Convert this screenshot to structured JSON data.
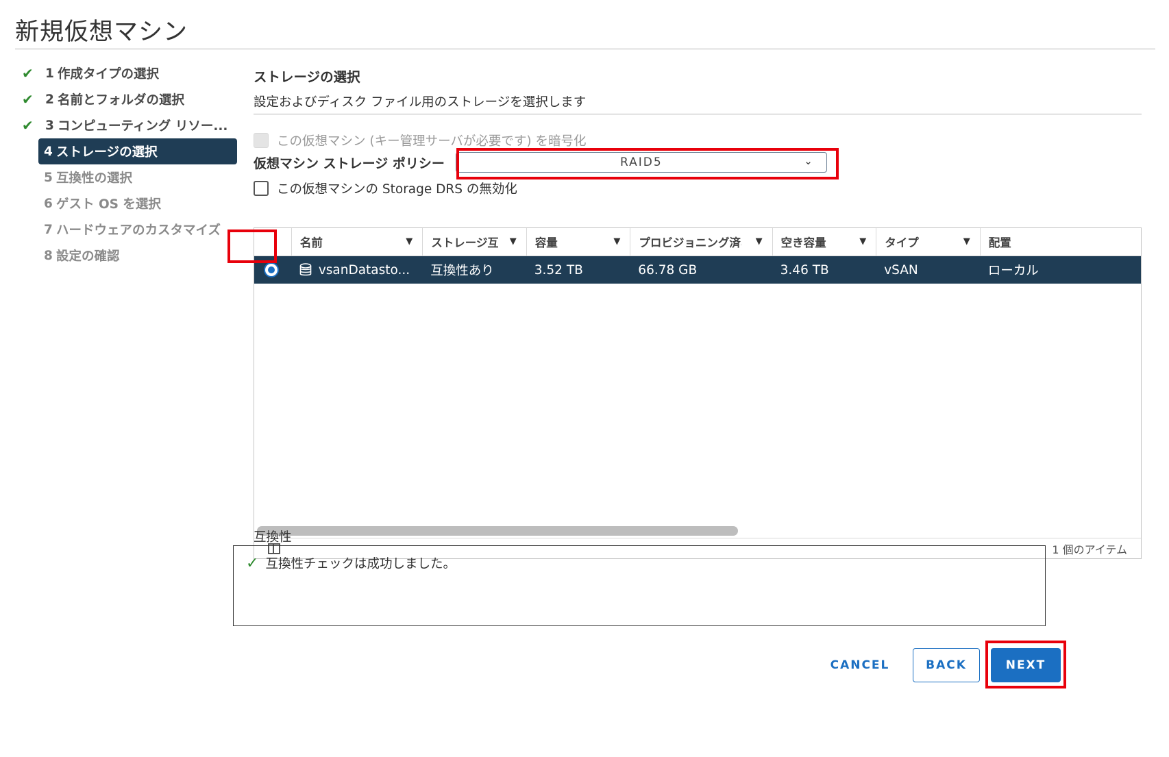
{
  "wizard": {
    "title": "新規仮想マシン",
    "steps": [
      {
        "num": "1",
        "label": "作成タイプの選択",
        "state": "done"
      },
      {
        "num": "2",
        "label": "名前とフォルダの選択",
        "state": "done"
      },
      {
        "num": "3",
        "label": "コンピューティング リソー...",
        "state": "done"
      },
      {
        "num": "4",
        "label": "ストレージの選択",
        "state": "active"
      },
      {
        "num": "5",
        "label": "互換性の選択",
        "state": "pending"
      },
      {
        "num": "6",
        "label": "ゲスト OS を選択",
        "state": "pending"
      },
      {
        "num": "7",
        "label": "ハードウェアのカスタマイズ",
        "state": "pending"
      },
      {
        "num": "8",
        "label": "設定の確認",
        "state": "pending"
      }
    ]
  },
  "storage": {
    "title": "ストレージの選択",
    "description": "設定およびディスク ファイル用のストレージを選択します",
    "encrypt_label": "この仮想マシン (キー管理サーバが必要です) を暗号化",
    "policy_label": "仮想マシン ストレージ ポリシー",
    "policy_value": "RAID5",
    "drs_label": "この仮想マシンの Storage DRS の無効化"
  },
  "grid": {
    "columns": [
      "名前",
      "ストレージ互",
      "容量",
      "プロビジョニング済み",
      "空き容量",
      "タイプ",
      "配置"
    ],
    "rows": [
      {
        "name": "vsanDatasto...",
        "compat": "互換性あり",
        "capacity": "3.52 TB",
        "provisioned": "66.78 GB",
        "free": "3.46 TB",
        "type": "vSAN",
        "placement": "ローカル"
      }
    ],
    "item_count": "1 個のアイテム"
  },
  "compatibility": {
    "label": "互換性",
    "message": "互換性チェックは成功しました。"
  },
  "buttons": {
    "cancel": "CANCEL",
    "back": "BACK",
    "next": "NEXT"
  },
  "colors": {
    "accent": "#1b6fc2",
    "active_step_bg": "#1f3d55",
    "success": "#2f8a2f",
    "highlight": "#e8000b"
  }
}
